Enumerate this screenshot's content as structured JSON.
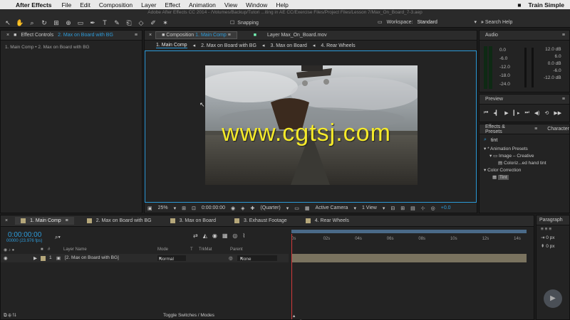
{
  "menubar": {
    "app_name": "After Effects",
    "items": [
      "File",
      "Edit",
      "Composition",
      "Layer",
      "Effect",
      "Animation",
      "View",
      "Window",
      "Help"
    ],
    "brand": "Train Simple"
  },
  "titlebar": {
    "title": "Adobe After Effects CC 2014 - /Volumes/Backup/Tutori ...iting in AE CC/Exercise Files/Project Files/Lesson 7/Max_On_Board_7-3.aep"
  },
  "toolbar": {
    "snapping_label": "Snapping",
    "workspace_label": "Workspace:",
    "workspace_value": "Standard",
    "search_help": "Search Help"
  },
  "effect_controls": {
    "tab_label": "Effect Controls",
    "tab_target": "2. Max on Board with BG",
    "breadcrumb": "1. Main Comp • 2. Max on Board with BG"
  },
  "composition": {
    "tab_label": "Composition",
    "tab_target": "1. Main Comp",
    "layer_tab": "Layer Max_On_Board.mov",
    "crumbs": [
      "1. Main Comp",
      "2. Max on Board with BG",
      "3. Max on Board",
      "4. Rear Wheels"
    ],
    "watermark": "www.cgtsj.com",
    "footer": {
      "zoom": "25%",
      "timecode": "0:00:00:00",
      "resolution": "(Quarter)",
      "camera": "Active Camera",
      "views": "1 View",
      "exposure": "+0.0"
    }
  },
  "audio": {
    "tab_label": "Audio",
    "left_levels": [
      "0.0",
      "-6.0",
      "-12.0",
      "-18.0",
      "-24.0"
    ],
    "right_levels": [
      "12.0 dB",
      "6.0",
      "0.0 dB",
      "-6.0",
      "-12.0 dB"
    ]
  },
  "preview": {
    "tab_label": "Preview"
  },
  "effects_presets": {
    "tab_label": "Effects & Presets",
    "tab2_label": "Character",
    "search_value": "tint",
    "tree": [
      "* Animation Presets",
      "Image – Creative",
      "Coloriz...ed hand tint",
      "Color Correction",
      "Tint"
    ]
  },
  "timeline": {
    "tabs": [
      {
        "label": "1. Main Comp",
        "color": "#b5a77a"
      },
      {
        "label": "2. Max on Board with BG",
        "color": "#b5a77a"
      },
      {
        "label": "3. Max on Board",
        "color": "#b5a77a"
      },
      {
        "label": "3. Exhaust Footage",
        "color": "#b5a77a"
      },
      {
        "label": "4. Rear Wheels",
        "color": "#b5a77a"
      }
    ],
    "current_time": "0:00:00:00",
    "fps": "00000 (23.976 fps)",
    "headers": {
      "layer_name": "Layer Name",
      "mode": "Mode",
      "t": "T",
      "trkmat": "TrkMat",
      "parent": "Parent"
    },
    "layer": {
      "index": "1",
      "name": "[2. Max on Board with BG]",
      "mode": "Normal",
      "parent": "None"
    },
    "ruler": [
      "0s",
      "02s",
      "04s",
      "06s",
      "08s",
      "10s",
      "12s",
      "14s"
    ],
    "toggle_label": "Toggle Switches / Modes"
  },
  "paragraph": {
    "tab_label": "Paragraph",
    "fields": [
      "0 px",
      "0 px"
    ]
  }
}
